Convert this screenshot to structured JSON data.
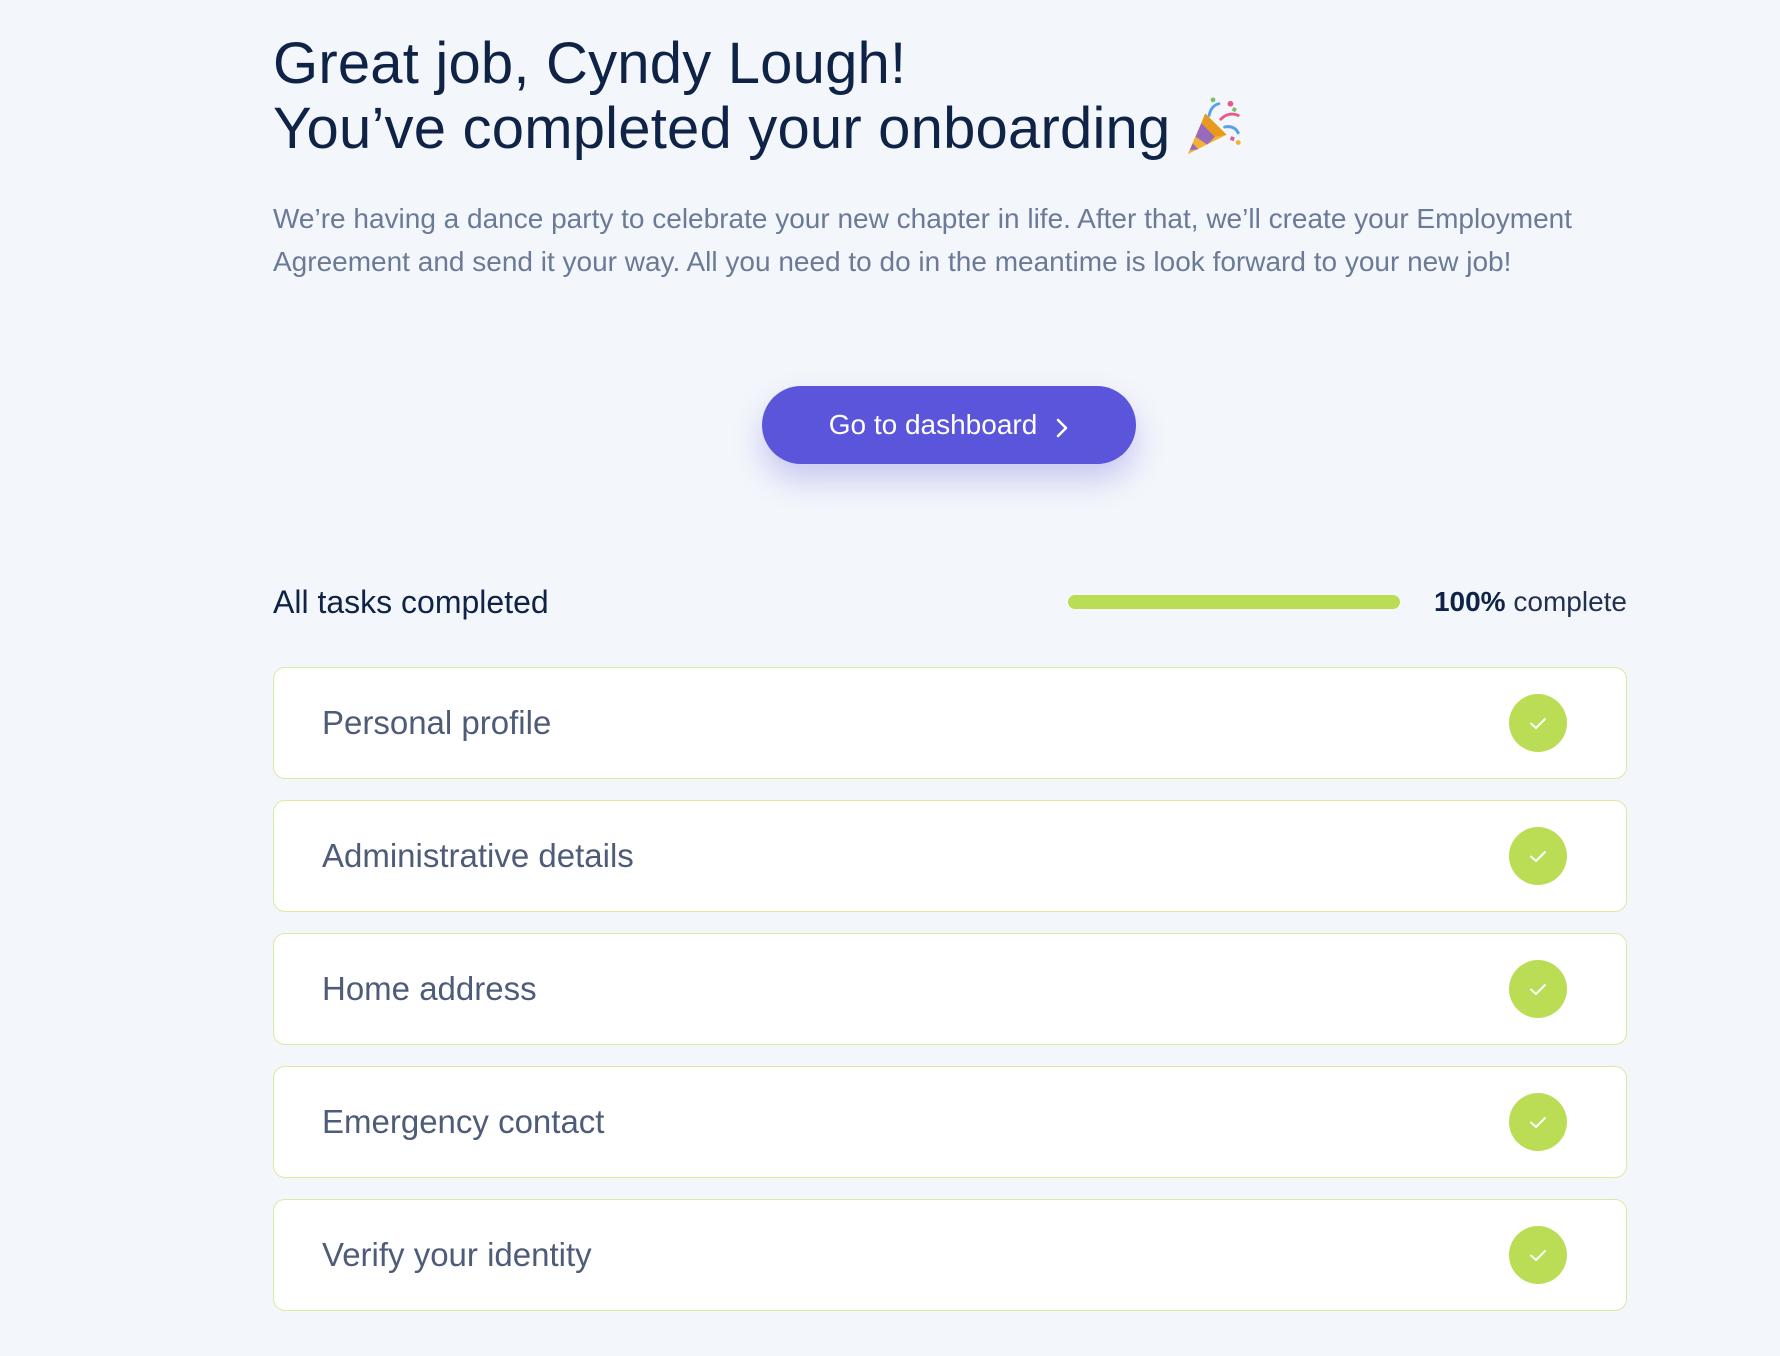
{
  "header": {
    "greeting": "Great job, Cyndy Lough!",
    "subheading": "You’ve completed your onboarding",
    "celebration_icon": "party-popper-icon"
  },
  "intro_text": "We’re having a dance party to celebrate your new chapter in life. After that, we’ll create your Employment Agreement and send it your way. All you need to do in the meantime is look forward to your new job!",
  "cta": {
    "label": "Go to dashboard",
    "icon": "chevron-right-icon",
    "color": "#5b55dc"
  },
  "progress": {
    "title": "All tasks completed",
    "percent": "100%",
    "percent_value": 100,
    "suffix": "complete",
    "color": "#bbdd55"
  },
  "tasks": [
    {
      "label": "Personal profile",
      "status": "completed",
      "icon": "check-icon"
    },
    {
      "label": "Administrative details",
      "status": "completed",
      "icon": "check-icon"
    },
    {
      "label": "Home address",
      "status": "completed",
      "icon": "check-icon"
    },
    {
      "label": "Emergency contact",
      "status": "completed",
      "icon": "check-icon"
    },
    {
      "label": "Verify your identity",
      "status": "completed",
      "icon": "check-icon"
    }
  ]
}
